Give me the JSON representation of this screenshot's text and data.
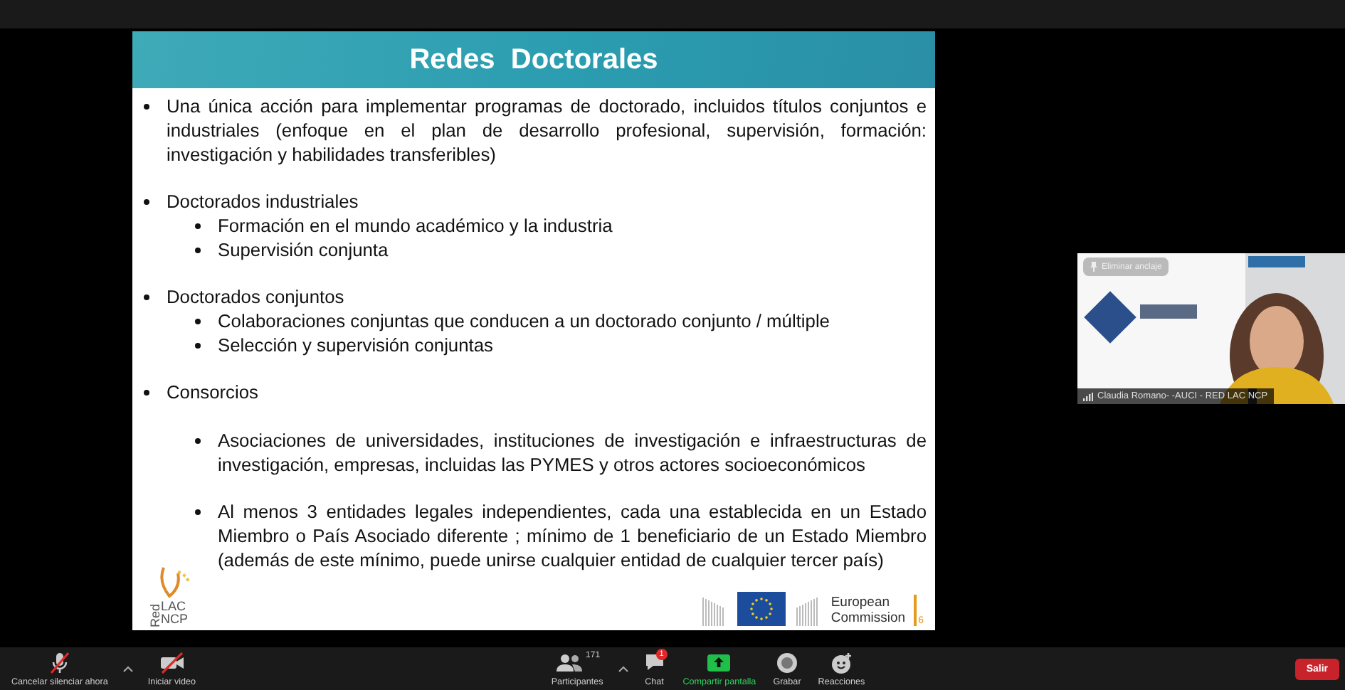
{
  "slide": {
    "title": "Redes  Doctorales",
    "bullets": [
      {
        "kind": "plain",
        "text": "Una única acción para implementar programas de doctorado, incluidos títulos conjuntos e industriales (enfoque en el plan de desarrollo profesional, supervisión, formación: investigación y habilidades transferibles)"
      },
      {
        "kind": "list",
        "text": "Doctorados industriales",
        "children": [
          {
            "text": "Formación en el mundo académico y la industria"
          },
          {
            "text": "Supervisión conjunta"
          }
        ]
      },
      {
        "kind": "list",
        "text": "Doctorados conjuntos",
        "children": [
          {
            "text": "Colaboraciones conjuntas que conducen a un doctorado conjunto / múltiple"
          },
          {
            "text": "Selección y supervisión conjuntas"
          }
        ]
      },
      {
        "kind": "paragraphs",
        "text": "Consorcios",
        "children": [
          {
            "text": "Asociaciones de universidades, instituciones de investigación e infraestructuras de investigación, empresas, incluidas las PYMES y otros actores socioeconómicos"
          },
          {
            "text": "Al menos 3 entidades legales independientes, cada una establecida en un Estado Miembro o País Asociado diferente ; mínimo de 1 beneficiario de un Estado Miembro (además de este mínimo, puede unirse cualquier entidad de cualquier tercer país)"
          }
        ]
      }
    ],
    "footer": {
      "logo_red": "Red",
      "logo_lac": "LAC",
      "logo_ncp": "NCP",
      "ec_line1": "European",
      "ec_line2": "Commission",
      "slide_number": "6"
    }
  },
  "video": {
    "kind": "picture",
    "unpin_button": "Eliminar anclaje",
    "name": "Claudia Romano- -AUCI - RED LAC NCP"
  },
  "toolbar": {
    "left": [
      {
        "kind": "mic-muted",
        "label": "Cancelar silenciar ahora",
        "caret": true
      },
      {
        "kind": "video-off",
        "label": "Iniciar video",
        "caret": false
      }
    ],
    "center": [
      {
        "kind": "participants",
        "label": "Participantes",
        "count": "171",
        "caret": true
      },
      {
        "kind": "chat",
        "label": "Chat",
        "badge": "1",
        "caret": false
      },
      {
        "kind": "share",
        "label": "Compartir pantalla",
        "caret": false
      },
      {
        "kind": "record",
        "label": "Grabar",
        "caret": false
      },
      {
        "kind": "reactions",
        "label": "Reacciones",
        "caret": false
      }
    ],
    "leave": "Salir"
  }
}
